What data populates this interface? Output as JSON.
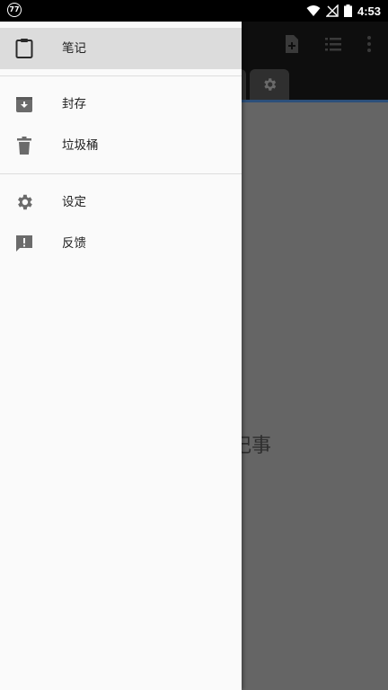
{
  "status_bar": {
    "notification_badge": "77",
    "time": "4:53",
    "icons": [
      "wifi-icon",
      "signal-off-icon",
      "battery-icon"
    ]
  },
  "toolbar": {
    "icons": [
      "new-note-icon",
      "list-view-icon",
      "more-options-icon"
    ]
  },
  "tabs": {
    "icons": [
      "settings-icon"
    ]
  },
  "content": {
    "empty_text_partial": "记事"
  },
  "drawer": {
    "items": [
      {
        "label": "笔记",
        "icon": "clipboard-icon",
        "active": true
      },
      {
        "label": "封存",
        "icon": "archive-icon",
        "active": false
      },
      {
        "label": "垃圾桶",
        "icon": "trash-icon",
        "active": false
      },
      {
        "label": "设定",
        "icon": "gear-icon",
        "active": false
      },
      {
        "label": "反馈",
        "icon": "feedback-icon",
        "active": false
      }
    ]
  },
  "colors": {
    "status_bar": "#000000",
    "drawer_bg": "#fafafa",
    "active_item_bg": "#dcdcdc",
    "scrim": "#656565",
    "icon_gray": "#6b6b6b",
    "tab_indicator": "#2c4f7a"
  }
}
